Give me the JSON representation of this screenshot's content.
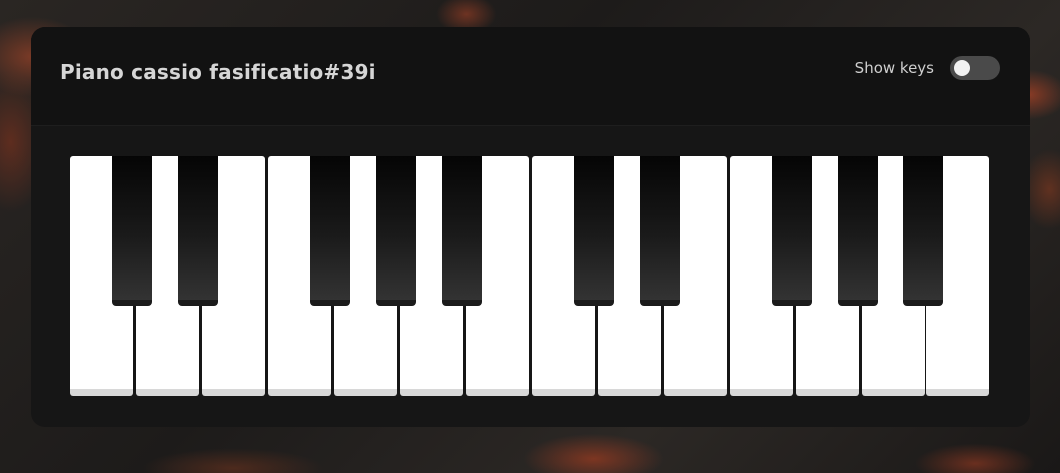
{
  "app": {
    "title": "Piano cassio fasificatio#39i"
  },
  "controls": {
    "show_keys_label": "Show keys",
    "show_keys_enabled": false
  },
  "keyboard": {
    "white_key_count": 14,
    "black_key_count": 10,
    "colors": {
      "white_key": "#ffffff",
      "black_key": "#0a0a0a",
      "panel": "#161616",
      "header": "#121212"
    }
  }
}
